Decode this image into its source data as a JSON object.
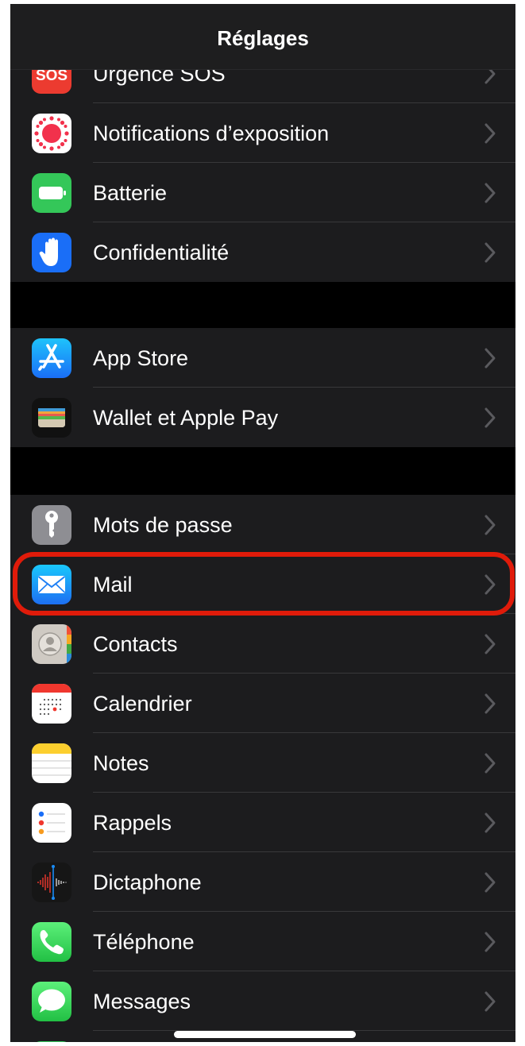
{
  "navbar": {
    "title": "Réglages"
  },
  "groups": [
    {
      "items": [
        {
          "label": "Urgence SOS",
          "icon": "sos-icon"
        },
        {
          "label": "Notifications d’exposition",
          "icon": "exposure-notifications-icon"
        },
        {
          "label": "Batterie",
          "icon": "battery-icon"
        },
        {
          "label": "Confidentialité",
          "icon": "privacy-hand-icon"
        }
      ]
    },
    {
      "items": [
        {
          "label": "App Store",
          "icon": "app-store-icon"
        },
        {
          "label": "Wallet et Apple Pay",
          "icon": "wallet-icon"
        }
      ]
    },
    {
      "items": [
        {
          "label": "Mots de passe",
          "icon": "key-icon"
        },
        {
          "label": "Mail",
          "icon": "mail-icon"
        },
        {
          "label": "Contacts",
          "icon": "contacts-icon"
        },
        {
          "label": "Calendrier",
          "icon": "calendar-icon"
        },
        {
          "label": "Notes",
          "icon": "notes-icon"
        },
        {
          "label": "Rappels",
          "icon": "reminders-icon"
        },
        {
          "label": "Dictaphone",
          "icon": "voice-memos-icon"
        },
        {
          "label": "Téléphone",
          "icon": "phone-icon"
        },
        {
          "label": "Messages",
          "icon": "messages-icon"
        }
      ]
    }
  ],
  "highlighted_item": "Mail",
  "colors": {
    "highlight": "#e01b0a",
    "cell_background": "#1c1c1e",
    "background": "#000000"
  }
}
